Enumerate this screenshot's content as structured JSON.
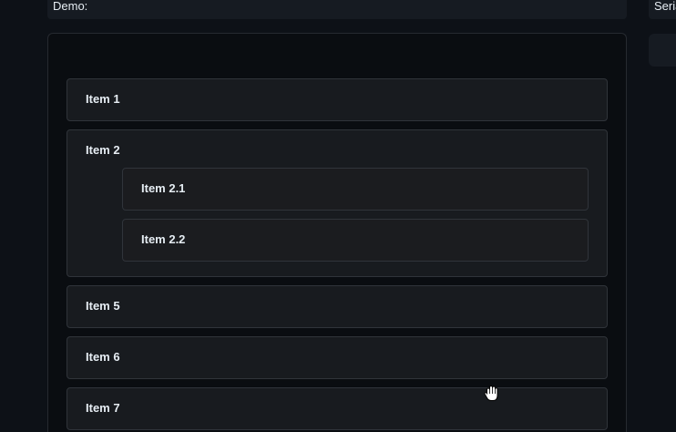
{
  "left_panel": {
    "header_label": "Demo:"
  },
  "right_panel": {
    "header_label": "Seria"
  },
  "list": {
    "items": [
      {
        "label": "Item 1"
      },
      {
        "label": "Item 2",
        "children": [
          {
            "label": "Item 2.1"
          },
          {
            "label": "Item 2.2"
          }
        ]
      },
      {
        "label": "Item 5"
      },
      {
        "label": "Item 6"
      },
      {
        "label": "Item 7"
      }
    ]
  },
  "cursor": {
    "icon": "grab-hand-cursor"
  }
}
